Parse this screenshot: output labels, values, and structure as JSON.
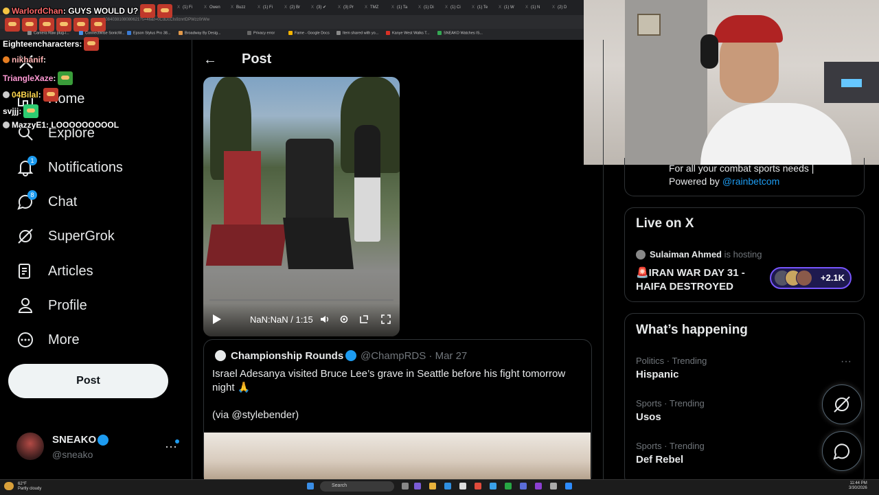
{
  "browser": {
    "tabs": [
      "(1) Fi",
      "Owen",
      "Buzz",
      "(1) Fi",
      "(2) Br",
      "(3) ✔",
      "(3) Pr",
      "TMZ",
      "(1) Ta",
      "(1) Di",
      "(1) Ci",
      "(1) Te",
      "(1) W",
      "(1) N",
      "(2) D"
    ],
    "address": "2084038108080621?s=46&t=0CdDcCIs9znrtDPWzz0rWw",
    "bookmarks": [
      "Camera Raw plug-i...",
      "ConnectWise SonicW...",
      "Epson Stylus Pro 38...",
      "Broadway By Desig...",
      "Privacy error",
      "Fame - Google Docs",
      "Item shared with yo...",
      "Kanye West Walks T...",
      "SNEAKO Watches IS..."
    ]
  },
  "chat": [
    {
      "user": "WarlordChan",
      "msg": "GUYS WOULD U?",
      "emotes": 2
    },
    {
      "user": "",
      "msg": "",
      "emotes": 6
    },
    {
      "user": "Eighteencharacters",
      "msg": "",
      "emotes": 1
    },
    {
      "user": "nikhanif",
      "msg": "",
      "emotes": 0
    },
    {
      "user": "TriangleXaze",
      "msg": "",
      "emotes": 1
    },
    {
      "user": "04Bilal",
      "msg": "",
      "emotes": 1
    },
    {
      "user": "svjjj",
      "msg": "",
      "emotes": 1
    },
    {
      "user": "MazzyE1",
      "msg": "LOOOOOOOOOL",
      "emotes": 0
    }
  ],
  "nav": {
    "items": [
      {
        "label": "Home"
      },
      {
        "label": "Explore"
      },
      {
        "label": "Notifications",
        "badge": "1"
      },
      {
        "label": "Chat",
        "badge": "8"
      },
      {
        "label": "SuperGrok"
      },
      {
        "label": "Articles"
      },
      {
        "label": "Profile"
      },
      {
        "label": "More"
      }
    ],
    "post_label": "Post"
  },
  "account": {
    "name": "SNEAKO",
    "handle": "@sneako",
    "more": "···"
  },
  "header": {
    "title": "Post",
    "back": "←"
  },
  "video": {
    "time": "NaN:NaN / 1:15"
  },
  "quote": {
    "name": "Championship Rounds",
    "handle": "@ChampRDS · Mar 27",
    "text": "Israel Adesanya visited Bruce Lee’s grave in Seattle before his fight tomorrow night 🙏",
    "via": "(via @stylebender)"
  },
  "promo": {
    "text": "For all your combat sports needs | Powered by ",
    "link": "@rainbetcom"
  },
  "live": {
    "title": "Live on X",
    "host": "Sulaiman Ahmed",
    "hosting": " is hosting",
    "space_title": "🚨IRAN WAR DAY 31 - HAIFA DESTROYED",
    "listeners": "+2.1K"
  },
  "happening": {
    "title": "What’s happening",
    "trends": [
      {
        "meta": "Politics · Trending",
        "name": "Hispanic"
      },
      {
        "meta": "Sports · Trending",
        "name": "Usos"
      },
      {
        "meta": "Sports · Trending",
        "name": "Def Rebel"
      }
    ],
    "more": "···"
  },
  "taskbar": {
    "temp": "62°F",
    "weather": "Partly cloudy",
    "search": "Search",
    "time": "11:44 PM",
    "date": "3/30/2026"
  },
  "colors": {
    "accent": "#1d9bf0",
    "space": "#7856ff",
    "bg": "#000000"
  }
}
